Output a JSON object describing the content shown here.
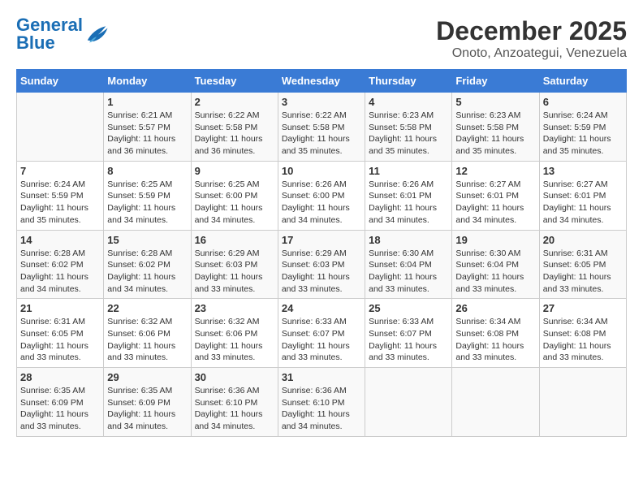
{
  "header": {
    "logo_general": "General",
    "logo_blue": "Blue",
    "title": "December 2025",
    "subtitle": "Onoto, Anzoategui, Venezuela"
  },
  "days_of_week": [
    "Sunday",
    "Monday",
    "Tuesday",
    "Wednesday",
    "Thursday",
    "Friday",
    "Saturday"
  ],
  "weeks": [
    [
      {
        "day": "",
        "info": ""
      },
      {
        "day": "1",
        "info": "Sunrise: 6:21 AM\nSunset: 5:57 PM\nDaylight: 11 hours and 36 minutes."
      },
      {
        "day": "2",
        "info": "Sunrise: 6:22 AM\nSunset: 5:58 PM\nDaylight: 11 hours and 36 minutes."
      },
      {
        "day": "3",
        "info": "Sunrise: 6:22 AM\nSunset: 5:58 PM\nDaylight: 11 hours and 35 minutes."
      },
      {
        "day": "4",
        "info": "Sunrise: 6:23 AM\nSunset: 5:58 PM\nDaylight: 11 hours and 35 minutes."
      },
      {
        "day": "5",
        "info": "Sunrise: 6:23 AM\nSunset: 5:58 PM\nDaylight: 11 hours and 35 minutes."
      },
      {
        "day": "6",
        "info": "Sunrise: 6:24 AM\nSunset: 5:59 PM\nDaylight: 11 hours and 35 minutes."
      }
    ],
    [
      {
        "day": "7",
        "info": "Sunrise: 6:24 AM\nSunset: 5:59 PM\nDaylight: 11 hours and 35 minutes."
      },
      {
        "day": "8",
        "info": "Sunrise: 6:25 AM\nSunset: 5:59 PM\nDaylight: 11 hours and 34 minutes."
      },
      {
        "day": "9",
        "info": "Sunrise: 6:25 AM\nSunset: 6:00 PM\nDaylight: 11 hours and 34 minutes."
      },
      {
        "day": "10",
        "info": "Sunrise: 6:26 AM\nSunset: 6:00 PM\nDaylight: 11 hours and 34 minutes."
      },
      {
        "day": "11",
        "info": "Sunrise: 6:26 AM\nSunset: 6:01 PM\nDaylight: 11 hours and 34 minutes."
      },
      {
        "day": "12",
        "info": "Sunrise: 6:27 AM\nSunset: 6:01 PM\nDaylight: 11 hours and 34 minutes."
      },
      {
        "day": "13",
        "info": "Sunrise: 6:27 AM\nSunset: 6:01 PM\nDaylight: 11 hours and 34 minutes."
      }
    ],
    [
      {
        "day": "14",
        "info": "Sunrise: 6:28 AM\nSunset: 6:02 PM\nDaylight: 11 hours and 34 minutes."
      },
      {
        "day": "15",
        "info": "Sunrise: 6:28 AM\nSunset: 6:02 PM\nDaylight: 11 hours and 34 minutes."
      },
      {
        "day": "16",
        "info": "Sunrise: 6:29 AM\nSunset: 6:03 PM\nDaylight: 11 hours and 33 minutes."
      },
      {
        "day": "17",
        "info": "Sunrise: 6:29 AM\nSunset: 6:03 PM\nDaylight: 11 hours and 33 minutes."
      },
      {
        "day": "18",
        "info": "Sunrise: 6:30 AM\nSunset: 6:04 PM\nDaylight: 11 hours and 33 minutes."
      },
      {
        "day": "19",
        "info": "Sunrise: 6:30 AM\nSunset: 6:04 PM\nDaylight: 11 hours and 33 minutes."
      },
      {
        "day": "20",
        "info": "Sunrise: 6:31 AM\nSunset: 6:05 PM\nDaylight: 11 hours and 33 minutes."
      }
    ],
    [
      {
        "day": "21",
        "info": "Sunrise: 6:31 AM\nSunset: 6:05 PM\nDaylight: 11 hours and 33 minutes."
      },
      {
        "day": "22",
        "info": "Sunrise: 6:32 AM\nSunset: 6:06 PM\nDaylight: 11 hours and 33 minutes."
      },
      {
        "day": "23",
        "info": "Sunrise: 6:32 AM\nSunset: 6:06 PM\nDaylight: 11 hours and 33 minutes."
      },
      {
        "day": "24",
        "info": "Sunrise: 6:33 AM\nSunset: 6:07 PM\nDaylight: 11 hours and 33 minutes."
      },
      {
        "day": "25",
        "info": "Sunrise: 6:33 AM\nSunset: 6:07 PM\nDaylight: 11 hours and 33 minutes."
      },
      {
        "day": "26",
        "info": "Sunrise: 6:34 AM\nSunset: 6:08 PM\nDaylight: 11 hours and 33 minutes."
      },
      {
        "day": "27",
        "info": "Sunrise: 6:34 AM\nSunset: 6:08 PM\nDaylight: 11 hours and 33 minutes."
      }
    ],
    [
      {
        "day": "28",
        "info": "Sunrise: 6:35 AM\nSunset: 6:09 PM\nDaylight: 11 hours and 33 minutes."
      },
      {
        "day": "29",
        "info": "Sunrise: 6:35 AM\nSunset: 6:09 PM\nDaylight: 11 hours and 34 minutes."
      },
      {
        "day": "30",
        "info": "Sunrise: 6:36 AM\nSunset: 6:10 PM\nDaylight: 11 hours and 34 minutes."
      },
      {
        "day": "31",
        "info": "Sunrise: 6:36 AM\nSunset: 6:10 PM\nDaylight: 11 hours and 34 minutes."
      },
      {
        "day": "",
        "info": ""
      },
      {
        "day": "",
        "info": ""
      },
      {
        "day": "",
        "info": ""
      }
    ]
  ]
}
